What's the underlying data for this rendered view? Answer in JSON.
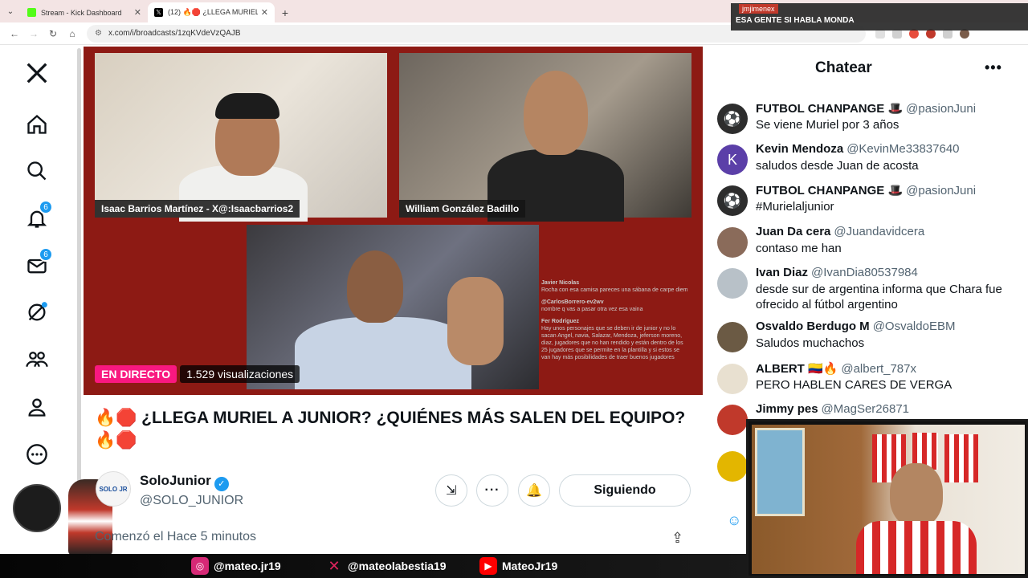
{
  "browser": {
    "tabs": [
      {
        "title": "Stream - Kick Dashboard",
        "favicon_color": "#53fc18",
        "active": false
      },
      {
        "title": "(12) 🔥🛑 ¿LLEGA MURIEL",
        "favicon_color": "#000000",
        "active": true
      }
    ],
    "url": "x.com/i/broadcasts/1zqKVdeVzQAJB"
  },
  "toast": {
    "user": "jmjimenex",
    "message": "ESA GENTE SI HABLA MONDA"
  },
  "nav": {
    "notifications_badge": "6",
    "messages_badge": "6"
  },
  "video": {
    "cam_a_name": "Isaac Barrios Martínez - X@:Isaacbarrios2",
    "cam_b_name": "William González Badillo",
    "live_label": "EN DIRECTO",
    "views_label": "1.529 visualizaciones",
    "overlay_chat": [
      {
        "user": "Javier Nicolas",
        "text": "Rocha con esa camisa pareces una sábana de carpe diem"
      },
      {
        "user": "@CarlosBorrero-ev2wv",
        "text": "nombre q vas a pasar otra vez esa vaina"
      },
      {
        "user": "Fer Rodríguez",
        "text": "Hay unos personajes que se deben ir de junior y no lo sacan Angel, navia, Salazar, Mendoza, jeferson moreno, diaz, jugadores que no han rendido y están dentro de los 25 jugadores que se permite en la plantilla y si estos se van hay más posibilidades de traer buenos jugadores"
      }
    ]
  },
  "post": {
    "title": "🔥🛑 ¿LLEGA MURIEL A JUNIOR? ¿QUIÉNES MÁS SALEN DEL EQUIPO? 🔥🛑",
    "author_name": "SoloJunior",
    "author_handle": "@SOLO_JUNIOR",
    "follow_label": "Siguiendo",
    "started": "Comenzó el Hace 5 minutos"
  },
  "chat": {
    "header": "Chatear",
    "messages": [
      {
        "name": "FUTBOL CHANPANGE 🎩",
        "handle": "@pasionJuni",
        "text": "Se viene Muriel por 3 años",
        "avatar_color": "#2d2d2d",
        "avatar_letter": "⚽"
      },
      {
        "name": "Kevin Mendoza",
        "handle": "@KevinMe33837640",
        "text": "saludos desde Juan de acosta",
        "avatar_color": "#5b3fa8",
        "avatar_letter": "K"
      },
      {
        "name": "FUTBOL CHANPANGE 🎩",
        "handle": "@pasionJuni",
        "text": "#Murielaljunior",
        "avatar_color": "#2d2d2d",
        "avatar_letter": "⚽"
      },
      {
        "name": "Juan Da cera",
        "handle": "@Juandavidcera",
        "text": "contaso me han",
        "avatar_color": "#8a6b5a",
        "avatar_letter": ""
      },
      {
        "name": "Ivan Diaz",
        "handle": "@IvanDia80537984",
        "text": "desde sur de argentina informa que Chara fue ofrecido al fútbol argentino",
        "avatar_color": "#b8c1c8",
        "avatar_letter": ""
      },
      {
        "name": "Osvaldo Berdugo M",
        "handle": "@OsvaldoEBM",
        "text": "Saludos muchachos",
        "avatar_color": "#6b5a44",
        "avatar_letter": ""
      },
      {
        "name": "ALBERT 🇨🇴🔥",
        "handle": "@albert_787x",
        "text": "PERO HABLEN CARES DE VERGA",
        "avatar_color": "#e8e0d0",
        "avatar_letter": ""
      },
      {
        "name": "Jimmy pes",
        "handle": "@MagSer26871",
        "text": "",
        "avatar_color": "#c0392b",
        "avatar_letter": ""
      }
    ]
  },
  "social": {
    "instagram": "@mateo.jr19",
    "x": "@mateolabestia19",
    "youtube": "MateoJr19"
  }
}
